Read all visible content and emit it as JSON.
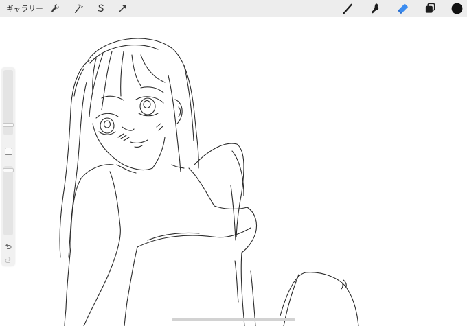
{
  "topbar": {
    "gallery_label": "ギャラリー",
    "left_tools": [
      "wrench-icon",
      "magic-wand-icon",
      "selection-s-icon",
      "transform-arrow-icon"
    ],
    "right_tools": [
      "brush-icon",
      "smudge-icon",
      "eraser-icon",
      "layers-icon",
      "color-icon"
    ],
    "colors": {
      "bar": "#ededed",
      "active_tool": "#3b8cf0",
      "current_color": "#111111"
    }
  },
  "sidebar": {
    "brush_size_level": 0.71,
    "opacity_level": 0.03,
    "modify_button_icon": "square-icon",
    "undo_icon": "undo-icon",
    "redo_icon": "redo-icon"
  },
  "canvas": {
    "background": "#ffffff",
    "content": "pencil-sketch"
  }
}
